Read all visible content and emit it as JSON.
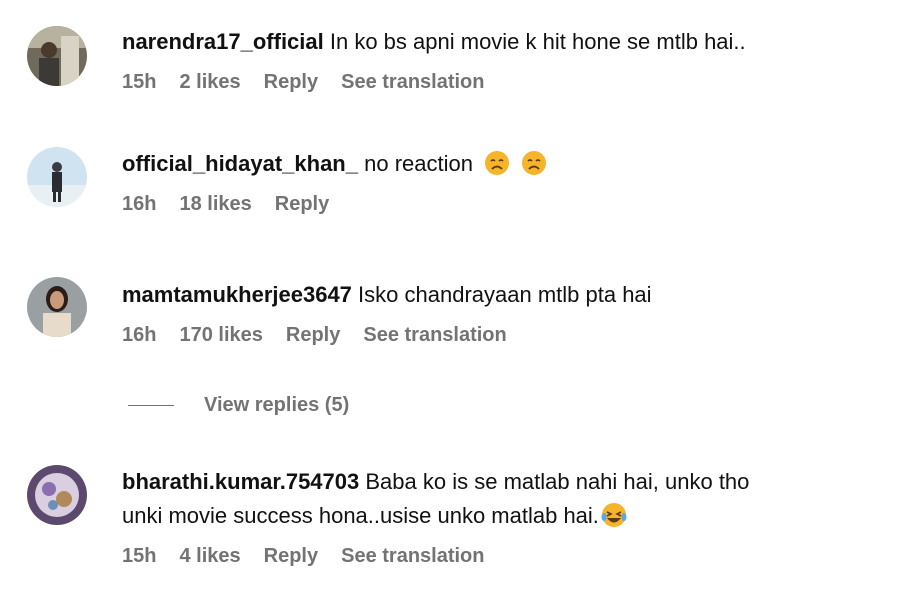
{
  "comments": [
    {
      "username": "narendra17_official",
      "text": "In ko bs apni movie k hit hone se mtlb hai..",
      "time": "15h",
      "likes": "2 likes",
      "reply": "Reply",
      "translation": "See translation"
    },
    {
      "username": "official_hidayat_khan_",
      "text": "no reaction",
      "emojis": [
        "weary-face-emoji",
        "weary-face-emoji"
      ],
      "time": "16h",
      "likes": "18 likes",
      "reply": "Reply"
    },
    {
      "username": "mamtamukherjee3647",
      "text": "Isko chandrayaan mtlb pta hai",
      "time": "16h",
      "likes": "170 likes",
      "reply": "Reply",
      "translation": "See translation"
    },
    {
      "username": "bharathi.kumar.754703",
      "text_line1": "Baba ko is se matlab nahi hai, unko tho",
      "text_line2": "unki movie success hona..usise unko matlab hai.",
      "emojis": [
        "laughing-tears-emoji"
      ],
      "time": "15h",
      "likes": "4 likes",
      "reply": "Reply",
      "translation": "See translation"
    }
  ],
  "view_replies": "View replies (5)",
  "colors": {
    "text": "#111111",
    "meta": "#737373",
    "emoji": "#f5b42a"
  }
}
